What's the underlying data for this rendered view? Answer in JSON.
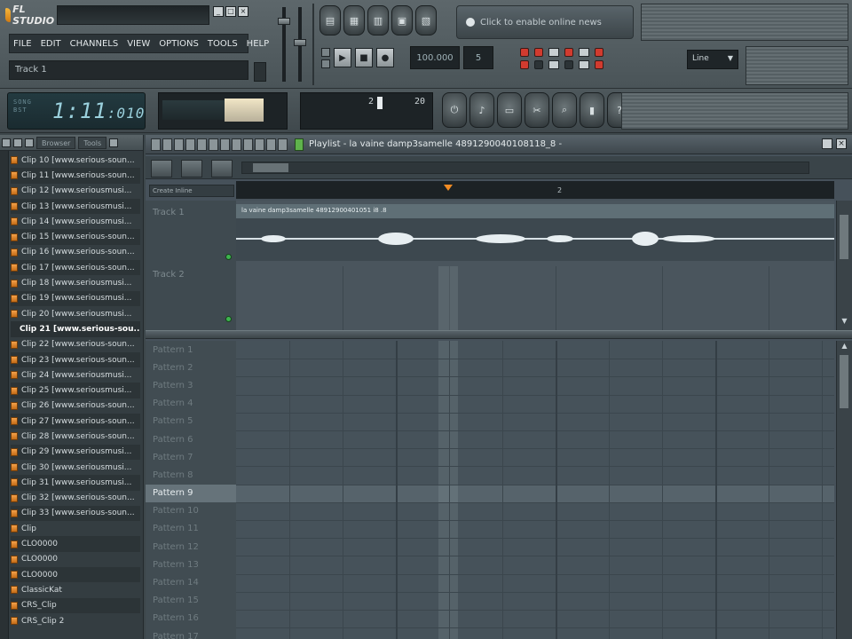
{
  "app": {
    "logo_text": "FL STUDIO",
    "window_buttons": [
      "_",
      "□",
      "×"
    ]
  },
  "menu": [
    "FILE",
    "EDIT",
    "CHANNELS",
    "VIEW",
    "OPTIONS",
    "TOOLS",
    "HELP"
  ],
  "hint_text": "Track 1",
  "news_text": "Click to enable online news",
  "transport": {
    "tempo": "100.000",
    "pattern_number": "5",
    "line_select": "Line"
  },
  "time_display": {
    "label_top": "SONG",
    "label_bottom": "BST",
    "value": "1:11",
    "sub_value": ":010"
  },
  "pattern_box": {
    "value1": "2",
    "value2": "20"
  },
  "browser": {
    "tab1": "Browser",
    "tab2": "Tools",
    "items": [
      "Clip 10 [www.serious-soun...",
      "Clip 11 [www.serious-soun...",
      "Clip 12 [www.seriousmusi...",
      "Clip 13 [www.seriousmusi...",
      "Clip 14 [www.seriousmusi...",
      "Clip 15 [www.serious-soun...",
      "Clip 16 [www.serious-soun...",
      "Clip 17 [www.serious-soun...",
      "Clip 18 [www.seriousmusi...",
      "Clip 19 [www.seriousmusi...",
      "Clip 20 [www.seriousmusi...",
      "Clip 21 [www.serious-sou...",
      "Clip 22 [www.serious-soun...",
      "Clip 23 [www.serious-soun...",
      "Clip 24 [www.seriousmusi...",
      "Clip 25 [www.seriousmusi...",
      "Clip 26 [www.serious-soun...",
      "Clip 27 [www.serious-soun...",
      "Clip 28 [www.serious-soun...",
      "Clip 29 [www.seriousmusi...",
      "Clip 30 [www.seriousmusi...",
      "Clip 31 [www.seriousmusi...",
      "Clip 32 [www.serious-soun...",
      "Clip 33 [www.serious-soun...",
      "Clip",
      "CLO0000",
      "CLO0000",
      "CLO0000",
      "ClassicKat",
      "CRS_Clip",
      "CRS_Clip 2"
    ],
    "selected_index": 11
  },
  "playlist": {
    "title": "Playlist - la vaine damp3samelle 4891290040108118_8 -",
    "ruler_label": "Create Inline",
    "ruler_tick": "2",
    "tracks": [
      "Track 1",
      "Track 2"
    ],
    "clip_name": "la vaine damp3samelle 48912900401051 i8 .8",
    "patterns": [
      "Pattern 1",
      "Pattern 2",
      "Pattern 3",
      "Pattern 4",
      "Pattern 5",
      "Pattern 6",
      "Pattern 7",
      "Pattern 8",
      "Pattern 9",
      "Pattern 10",
      "Pattern 11",
      "Pattern 12",
      "Pattern 13",
      "Pattern 14",
      "Pattern 15",
      "Pattern 16",
      "Pattern 17"
    ],
    "selected_pattern_index": 8
  },
  "colors": {
    "accent_orange": "#f18b23",
    "led_green": "#3db44e",
    "led_red": "#d13b2f",
    "play_green": "#5fb24c"
  }
}
